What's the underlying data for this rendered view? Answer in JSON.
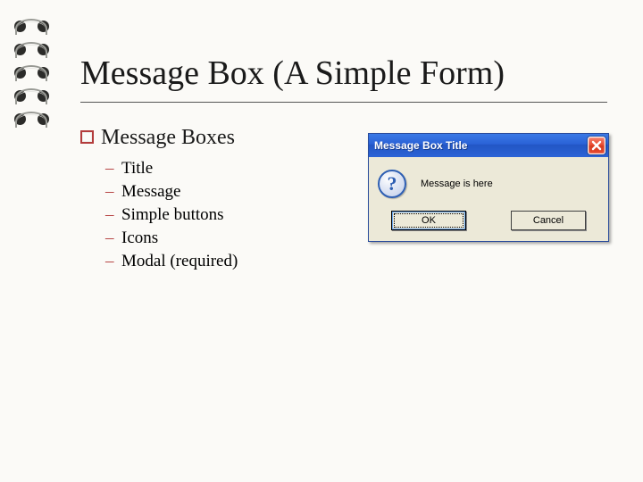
{
  "slide": {
    "title": "Message Box (A Simple Form)",
    "bullet_header": "Message Boxes",
    "sub_bullets": [
      "Title",
      "Message",
      "Simple buttons",
      "Icons",
      "Modal (required)"
    ]
  },
  "msgbox": {
    "window_title": "Message Box Title",
    "icon": "question-mark",
    "icon_glyph": "?",
    "message": "Message is here",
    "ok_label": "OK",
    "cancel_label": "Cancel"
  }
}
